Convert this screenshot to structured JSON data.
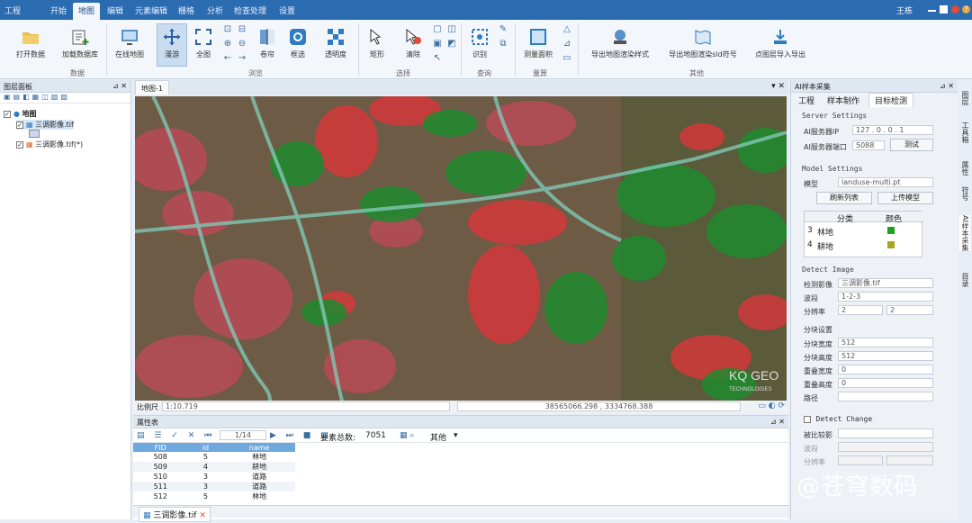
{
  "menu_tabs": [
    "工程",
    "开始",
    "地图",
    "编辑",
    "元素编辑",
    "栅格",
    "分析",
    "检查处理",
    "设置"
  ],
  "user": {
    "name": "王栋"
  },
  "ribbon": {
    "buttons": [
      "打开数据",
      "加载数据库",
      "在线地图",
      "漫游",
      "全图",
      "框选",
      "缩放",
      "透明度",
      "选择",
      "清除",
      "识别",
      "测量面积",
      "导出地图渲染样式",
      "导出地图渲染sld符号",
      "点图层导入导出"
    ],
    "small_labels": {
      "select_shape": "矩形",
      "swipe": "卷帘"
    },
    "groups": [
      "数据",
      "浏览",
      "选择",
      "查询",
      "量算",
      "其他"
    ]
  },
  "layer_panel": {
    "title": "图层面板",
    "root": "地图",
    "layers": [
      "三调影像.tif",
      "三调影像.tif(*)"
    ]
  },
  "map_tab": "地图-1",
  "status": {
    "scale_label": "比例尺",
    "scale_value": "1:10.719",
    "coords": "38565066.298 , 3334768.388"
  },
  "map_watermark": {
    "line1": "KQ GEO",
    "line2": "TECHNOLOGIES"
  },
  "attr_table": {
    "title": "属性表",
    "pager": "1/14",
    "total_label": "要素总数:",
    "total": "7051",
    "other_label": "其他",
    "columns": [
      "FID",
      "id",
      "name"
    ],
    "rows": [
      [
        "508",
        "5",
        "林地"
      ],
      [
        "509",
        "4",
        "耕地"
      ],
      [
        "510",
        "3",
        "道路"
      ],
      [
        "511",
        "3",
        "道路"
      ],
      [
        "512",
        "5",
        "林地"
      ]
    ],
    "tab_label": "三调影像.tif"
  },
  "right_panel": {
    "title": "AI样本采集",
    "tabs": [
      "工程",
      "样本制作",
      "目标检测"
    ],
    "server_section": "Server Settings",
    "ip_label": "AI服务器IP",
    "ip_value": "127 . 0 . 0 . 1",
    "port_label": "AI服务器端口",
    "port_value": "5088",
    "test_btn": "测试",
    "model_section": "Model Settings",
    "model_label": "模型",
    "model_value": "landuse-multi.pt",
    "refresh_btn": "刷新列表",
    "upload_btn": "上传模型",
    "class_header": "分类",
    "color_header": "颜色",
    "class_rows": [
      {
        "idx": "3",
        "name": "林地",
        "color": "#1fa31f"
      },
      {
        "idx": "4",
        "name": "耕地",
        "color": "#a7a51c"
      }
    ],
    "detect_section": "Detect Image",
    "image_label": "检测影像",
    "image_value": "三调影像.tif",
    "band_label": "波段",
    "band_value": "1-2-3",
    "res_label": "分辨率",
    "res_x": "2",
    "res_y": "2",
    "split_section": "分块设置",
    "split_w_label": "分块宽度",
    "split_w": "512",
    "split_h_label": "分块高度",
    "split_h": "512",
    "overlap_w_label": "重叠宽度",
    "overlap_w": "0",
    "overlap_h_label": "重叠高度",
    "overlap_h": "0",
    "path_label": "路径",
    "change_section": "Detect Change",
    "cmp_label": "被比较影",
    "band2_label": "波段",
    "res2_label": "分辨率"
  },
  "side_tabs": [
    "图层",
    "工具箱",
    "属性",
    "符号",
    "AI样本采集",
    "目录"
  ],
  "watermark": "知乎 @苍穹数码"
}
